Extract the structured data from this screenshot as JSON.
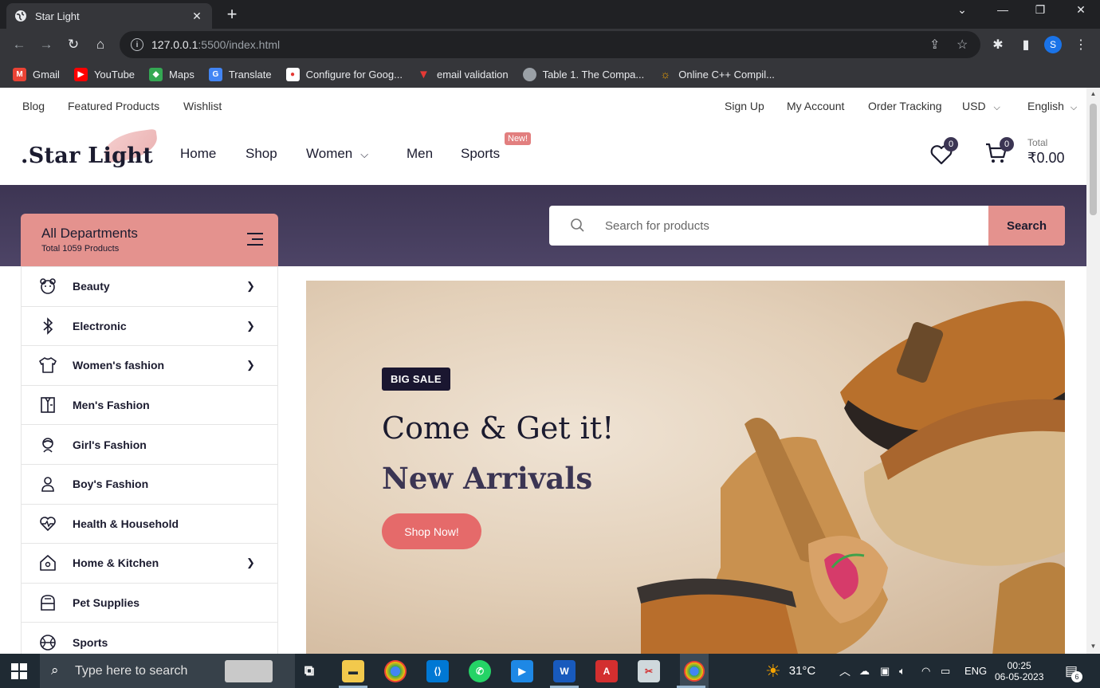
{
  "browser": {
    "tab_title": "Star Light",
    "url_host": "127.0.0.1",
    "url_rest": ":5500/index.html",
    "profile_initial": "S",
    "bookmarks": [
      {
        "label": "Gmail",
        "icon": "gmail-icon",
        "color": "#ea4335"
      },
      {
        "label": "YouTube",
        "icon": "youtube-icon",
        "color": "#ff0000"
      },
      {
        "label": "Maps",
        "icon": "maps-icon",
        "color": "#34a853"
      },
      {
        "label": "Translate",
        "icon": "translate-icon",
        "color": "#4285f4"
      },
      {
        "label": "Configure for Goog...",
        "icon": "configure-icon",
        "color": "#ffffff"
      },
      {
        "label": "email validation",
        "icon": "email-validation-icon",
        "color": "#e53935"
      },
      {
        "label": "Table 1. The Compa...",
        "icon": "globe-icon",
        "color": "#9aa0a6"
      },
      {
        "label": "Online C++ Compil...",
        "icon": "compiler-icon",
        "color": "#f4a300"
      }
    ]
  },
  "topbar": {
    "left": [
      "Blog",
      "Featured Products",
      "Wishlist"
    ],
    "right": [
      "Sign Up",
      "My Account",
      "Order Tracking"
    ],
    "currency": "USD",
    "language": "English"
  },
  "header": {
    "logo": ".Star Light",
    "nav": [
      "Home",
      "Shop",
      "Women",
      "Men",
      "Sports"
    ],
    "new_badge": "New!",
    "wishlist_count": "0",
    "cart_count": "0",
    "total_label": "Total",
    "total_value": "₹0.00"
  },
  "departments": {
    "title": "All Departments",
    "subtitle": "Total 1059 Products",
    "items": [
      {
        "label": "Beauty",
        "icon": "bear-icon",
        "chevron": true
      },
      {
        "label": "Electronic",
        "icon": "bluetooth-icon",
        "chevron": true
      },
      {
        "label": "Women's fashion",
        "icon": "tshirt-icon",
        "chevron": true
      },
      {
        "label": "Men's Fashion",
        "icon": "shirt-icon",
        "chevron": false
      },
      {
        "label": "Girl's Fashion",
        "icon": "girl-icon",
        "chevron": false
      },
      {
        "label": "Boy's Fashion",
        "icon": "person-icon",
        "chevron": false
      },
      {
        "label": "Health & Household",
        "icon": "heartbeat-icon",
        "chevron": false
      },
      {
        "label": "Home & Kitchen",
        "icon": "house-icon",
        "chevron": true
      },
      {
        "label": "Pet Supplies",
        "icon": "pet-carrier-icon",
        "chevron": false
      },
      {
        "label": "Sports",
        "icon": "ball-icon",
        "chevron": false
      }
    ]
  },
  "search": {
    "placeholder": "Search for products",
    "button": "Search"
  },
  "hero": {
    "badge": "BIG SALE",
    "title": "Come & Get it!",
    "subtitle": "New Arrivals",
    "button": "Shop Now!"
  },
  "taskbar": {
    "search_placeholder": "Type here to search",
    "temperature": "31°C",
    "language": "ENG",
    "time": "00:25",
    "date": "06-05-2023",
    "notifications": "6"
  }
}
